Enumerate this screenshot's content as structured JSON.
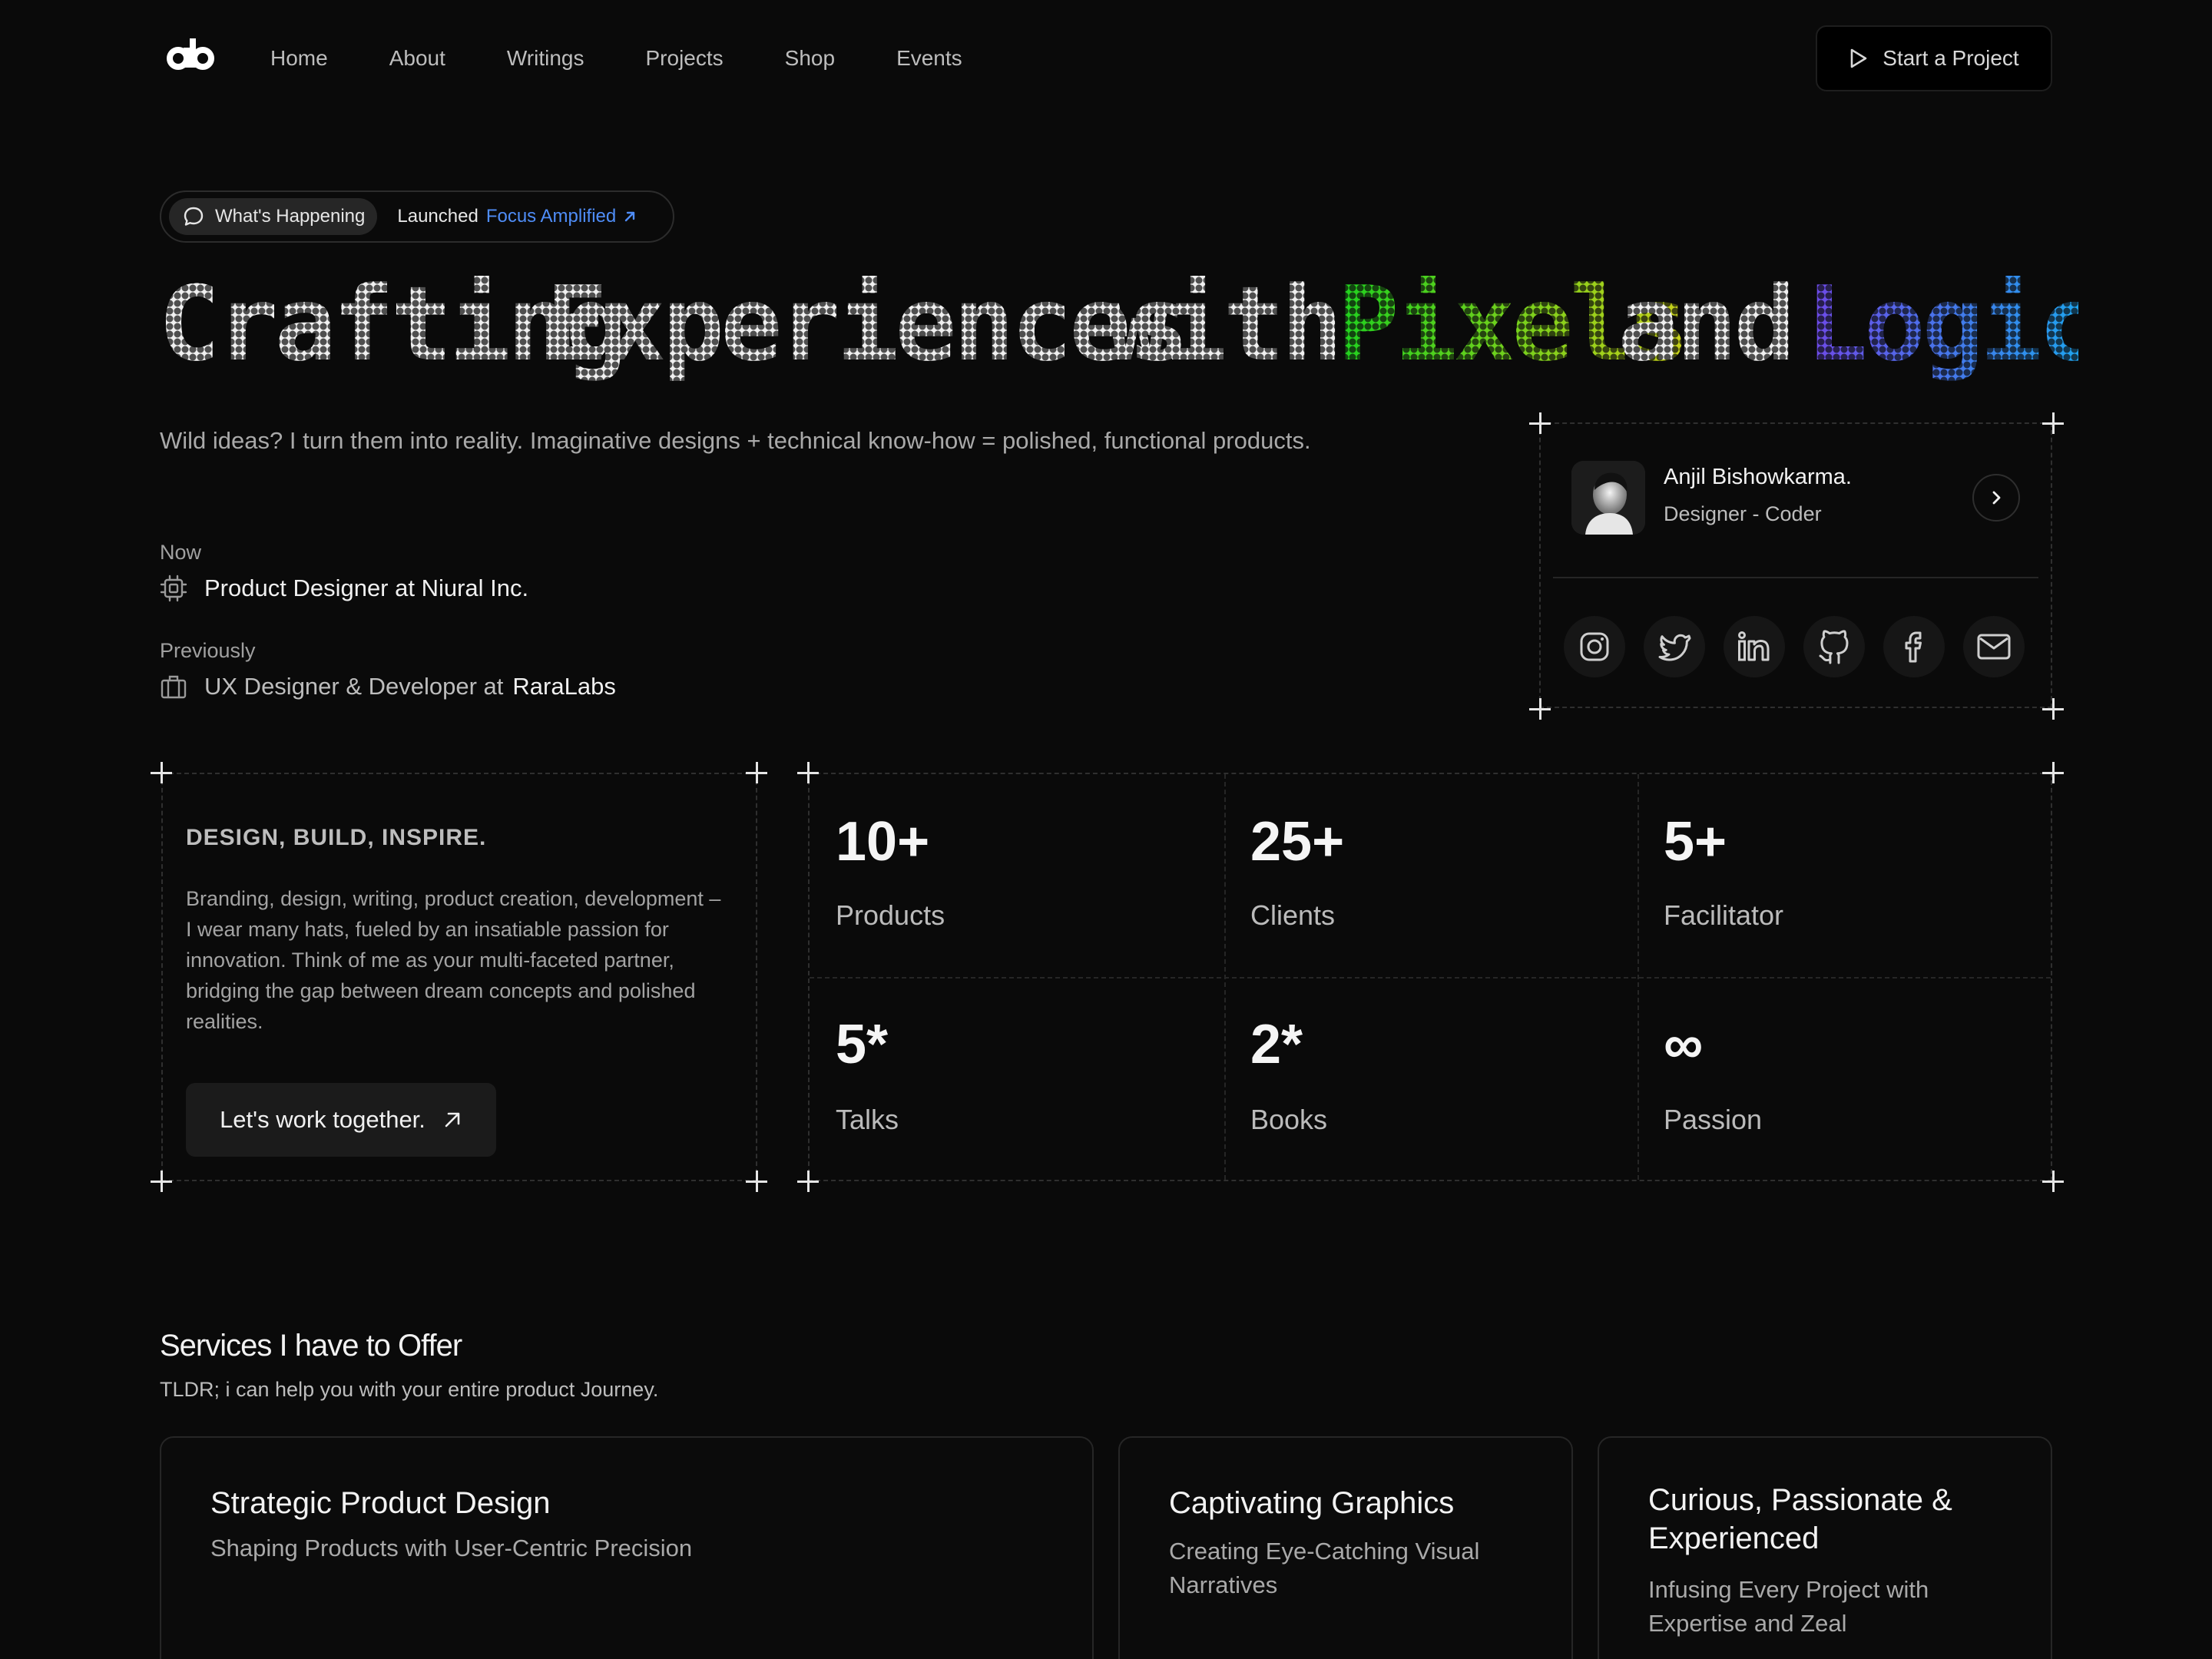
{
  "nav": {
    "items": [
      "Home",
      "About",
      "Writings",
      "Projects",
      "Shop",
      "Events"
    ],
    "cta_label": "Start a Project"
  },
  "announcement": {
    "tag": "What's Happening",
    "text": "Launched",
    "link": "Focus Amplified"
  },
  "hero": {
    "words": [
      "Crafting",
      "Experiences",
      "with",
      "Pixels",
      "and",
      "Logic"
    ]
  },
  "lead": "Wild ideas? I turn them into reality. Imaginative designs + technical know-how = polished, functional products.",
  "work": {
    "now_label": "Now",
    "now_role": "Product Designer at Niural Inc.",
    "prev_label": "Previously",
    "prev_role": "UX Designer & Developer at",
    "prev_company": "RaraLabs"
  },
  "profile": {
    "name": "Anjil Bishowkarma.",
    "role": "Designer - Coder",
    "socials": [
      "instagram-icon",
      "twitter-icon",
      "linkedin-icon",
      "github-icon",
      "facebook-icon",
      "mail-icon"
    ]
  },
  "about": {
    "title": "DESIGN, BUILD, INSPIRE.",
    "body": "Branding, design, writing, product creation, development – I wear many hats, fueled by an insatiable passion for innovation. Think of me as your multi-faceted partner, bridging the gap between dream concepts and polished realities.",
    "button": "Let's work together."
  },
  "stats": [
    {
      "value": "10+",
      "label": "Products"
    },
    {
      "value": "25+",
      "label": "Clients"
    },
    {
      "value": "5+",
      "label": "Facilitator"
    },
    {
      "value": "5*",
      "label": "Talks"
    },
    {
      "value": "2*",
      "label": "Books"
    },
    {
      "value": "∞",
      "label": "Passion"
    }
  ],
  "services": {
    "title": "Services I have to Offer",
    "subtitle": "TLDR; i can help you with your entire product Journey.",
    "cards": [
      {
        "title": "Strategic Product Design",
        "subtitle": "Shaping Products with User-Centric Precision"
      },
      {
        "title": "Captivating Graphics",
        "subtitle": "Creating Eye-Catching Visual Narratives"
      },
      {
        "title": "Curious, Passionate & Experienced",
        "subtitle": "Infusing Every Project with Expertise and Zeal"
      }
    ]
  },
  "colors": {
    "background": "#0a0a0a",
    "link": "#4f8df7",
    "pixels_gradient": [
      "#1fd11f",
      "#c9d11a"
    ],
    "logic_gradient": [
      "#7048e8",
      "#1aa9f0"
    ]
  }
}
